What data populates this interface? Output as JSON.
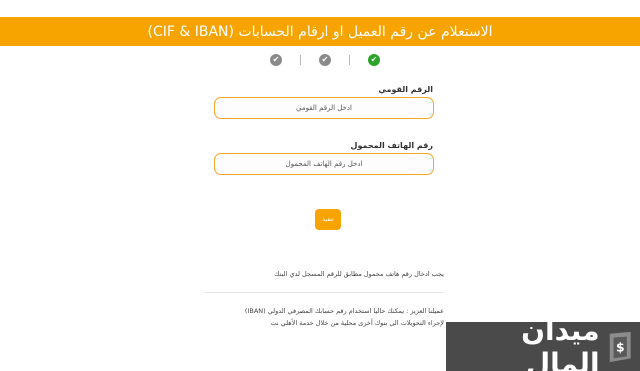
{
  "header": {
    "title": "الاستعلام عن رقم العميل او ارقام الحسابات (CIF & IBAN)"
  },
  "steps": [
    {
      "state": "done",
      "icon": "check-icon"
    },
    {
      "state": "pending",
      "icon": "check-icon"
    },
    {
      "state": "pending",
      "icon": "check-icon"
    }
  ],
  "form": {
    "national_id": {
      "label": "الرقم القومي",
      "placeholder": "ادخل الرقم القومي",
      "value": ""
    },
    "mobile": {
      "label": "رقم الهاتف المحمول",
      "placeholder": "ادخل رقم الهاتف المحمول",
      "value": ""
    },
    "submit_label": "تنفيذ"
  },
  "notes": {
    "mobile_note": "يجب ادخال رقم هاتف محمول مطابق للرقم المسجل لدي البنك",
    "info_line1": "عميلنا العزيز : يمكنك حاليا استخدام رقم حسابك المصرفي الدولي (IBAN)",
    "info_line2": "لإجراء التحويلات الى بنوك أخرى محلية من خلال خدمة الأهلي نت"
  },
  "watermark": {
    "text": "ميدان المال"
  },
  "colors": {
    "accent": "#f7a400",
    "done": "#2aa52a",
    "pending": "#8a8a8a"
  }
}
